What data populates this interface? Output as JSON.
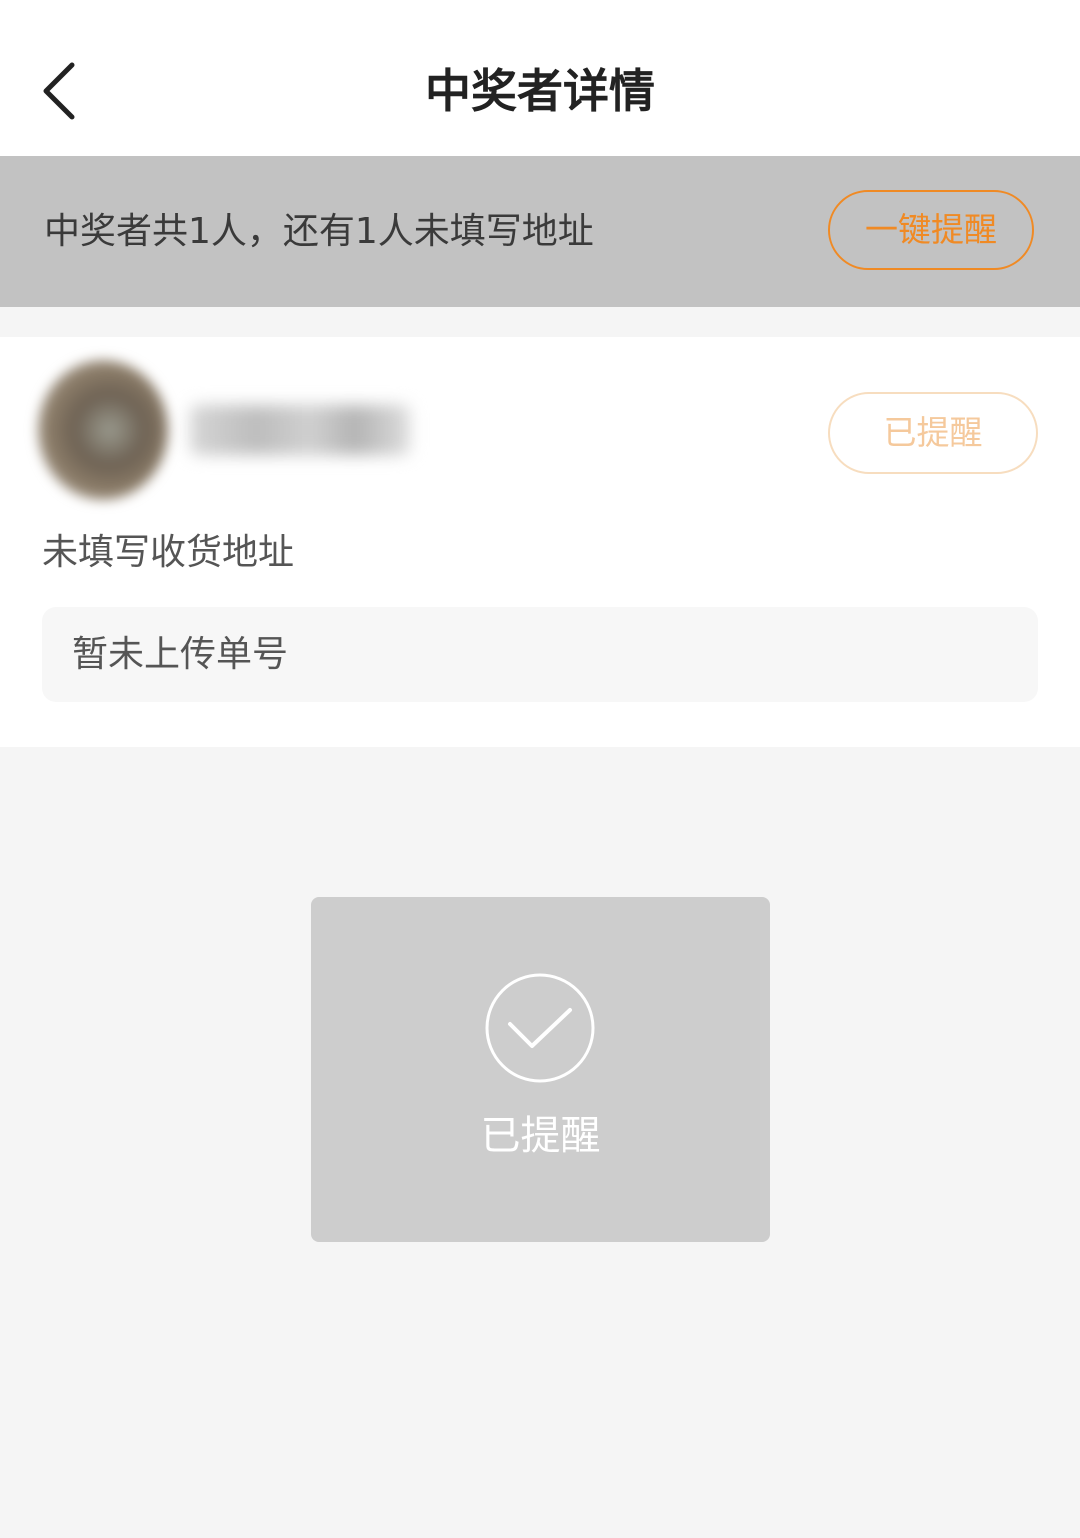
{
  "header": {
    "title": "中奖者详情",
    "back_icon": "chevron-left-icon"
  },
  "banner": {
    "summary": "中奖者共1人，还有1人未填写地址",
    "remind_all_label": "一键提醒"
  },
  "winner": {
    "remind_status_label": "已提醒",
    "address_status": "未填写收货地址",
    "tracking_status": "暂未上传单号"
  },
  "toast": {
    "icon": "check-circle-icon",
    "message": "已提醒"
  },
  "colors": {
    "accent": "#f08a24",
    "accent_faded": "#f5c99c",
    "banner_bg": "#c2c2c2",
    "toast_bg": "#cdcdcd"
  }
}
